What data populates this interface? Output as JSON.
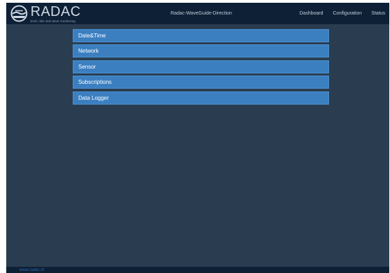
{
  "brand": {
    "name": "RADAC",
    "tagline": "level, tide and wave monitoring"
  },
  "header": {
    "device_title": "Radac-WaveGuide-Direction"
  },
  "nav": {
    "items": [
      {
        "label": "Dashboard"
      },
      {
        "label": "Configuration"
      },
      {
        "label": "Status"
      }
    ]
  },
  "menu": {
    "items": [
      {
        "label": "Date&Time"
      },
      {
        "label": "Network"
      },
      {
        "label": "Sensor"
      },
      {
        "label": "Subscriptions"
      },
      {
        "label": "Data Logger"
      }
    ]
  },
  "footer": {
    "link": "www.radac.nl"
  },
  "colors": {
    "header_bg": "#0d2036",
    "page_bg": "#2a3d50",
    "menu_item_bg": "#3b7fc1",
    "footer_link": "#2f62a8"
  }
}
